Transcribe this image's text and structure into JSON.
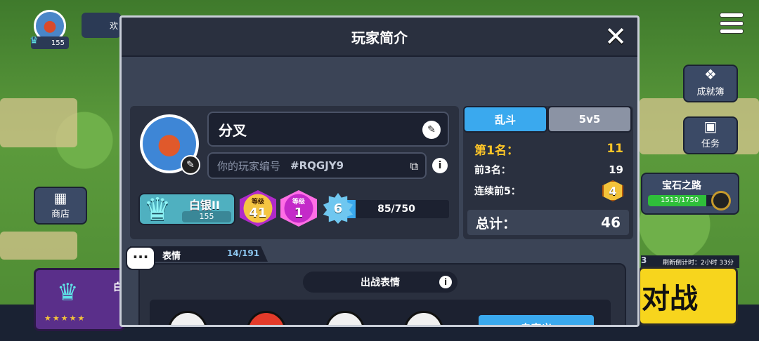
{
  "hud": {
    "trophies": "155",
    "news_label": "欢",
    "side_buttons": {
      "achievements": "成就簿",
      "quests": "任务",
      "shop": "商店"
    },
    "gem_road": {
      "title": "宝石之路",
      "progress_text": "1513/1750",
      "progress_fraction": 0.865
    },
    "refresh_count": "3",
    "refresh_text": "刷新倒计时：2小时 33分",
    "battle_label": "对战",
    "left_card_label": "白"
  },
  "modal": {
    "title": "玩家简介",
    "close_icon": "close-icon",
    "player": {
      "name": "分叉",
      "tag_label": "你的玩家编号",
      "tag_value": "#RQGJY9",
      "rank_name": "白银II",
      "rank_trophies": "155",
      "level_label_1": "等级",
      "level_value_1": "41",
      "level_label_2": "等级",
      "level_value_2": "1",
      "xp_level": "6",
      "xp_text": "85/750",
      "xp_fraction": 0.113
    },
    "stats": {
      "tabs": [
        "乱斗",
        "5v5"
      ],
      "active_tab": 0,
      "first_label": "第1名：",
      "first_value": "11",
      "top3_label": "前3名：",
      "top3_value": "19",
      "streak_label": "连续前5：",
      "streak_value": "4",
      "total_label": "总计：",
      "total_value": "46"
    },
    "emotes": {
      "section_label": "表情",
      "count": "14/191",
      "battle_emotes_label": "出战表情",
      "customize_label": "自定义"
    }
  },
  "colors": {
    "accent_blue": "#3aa9ee",
    "gold": "#ffc627",
    "panel_dark": "#2a303f",
    "battle_yellow": "#f7d51d"
  }
}
